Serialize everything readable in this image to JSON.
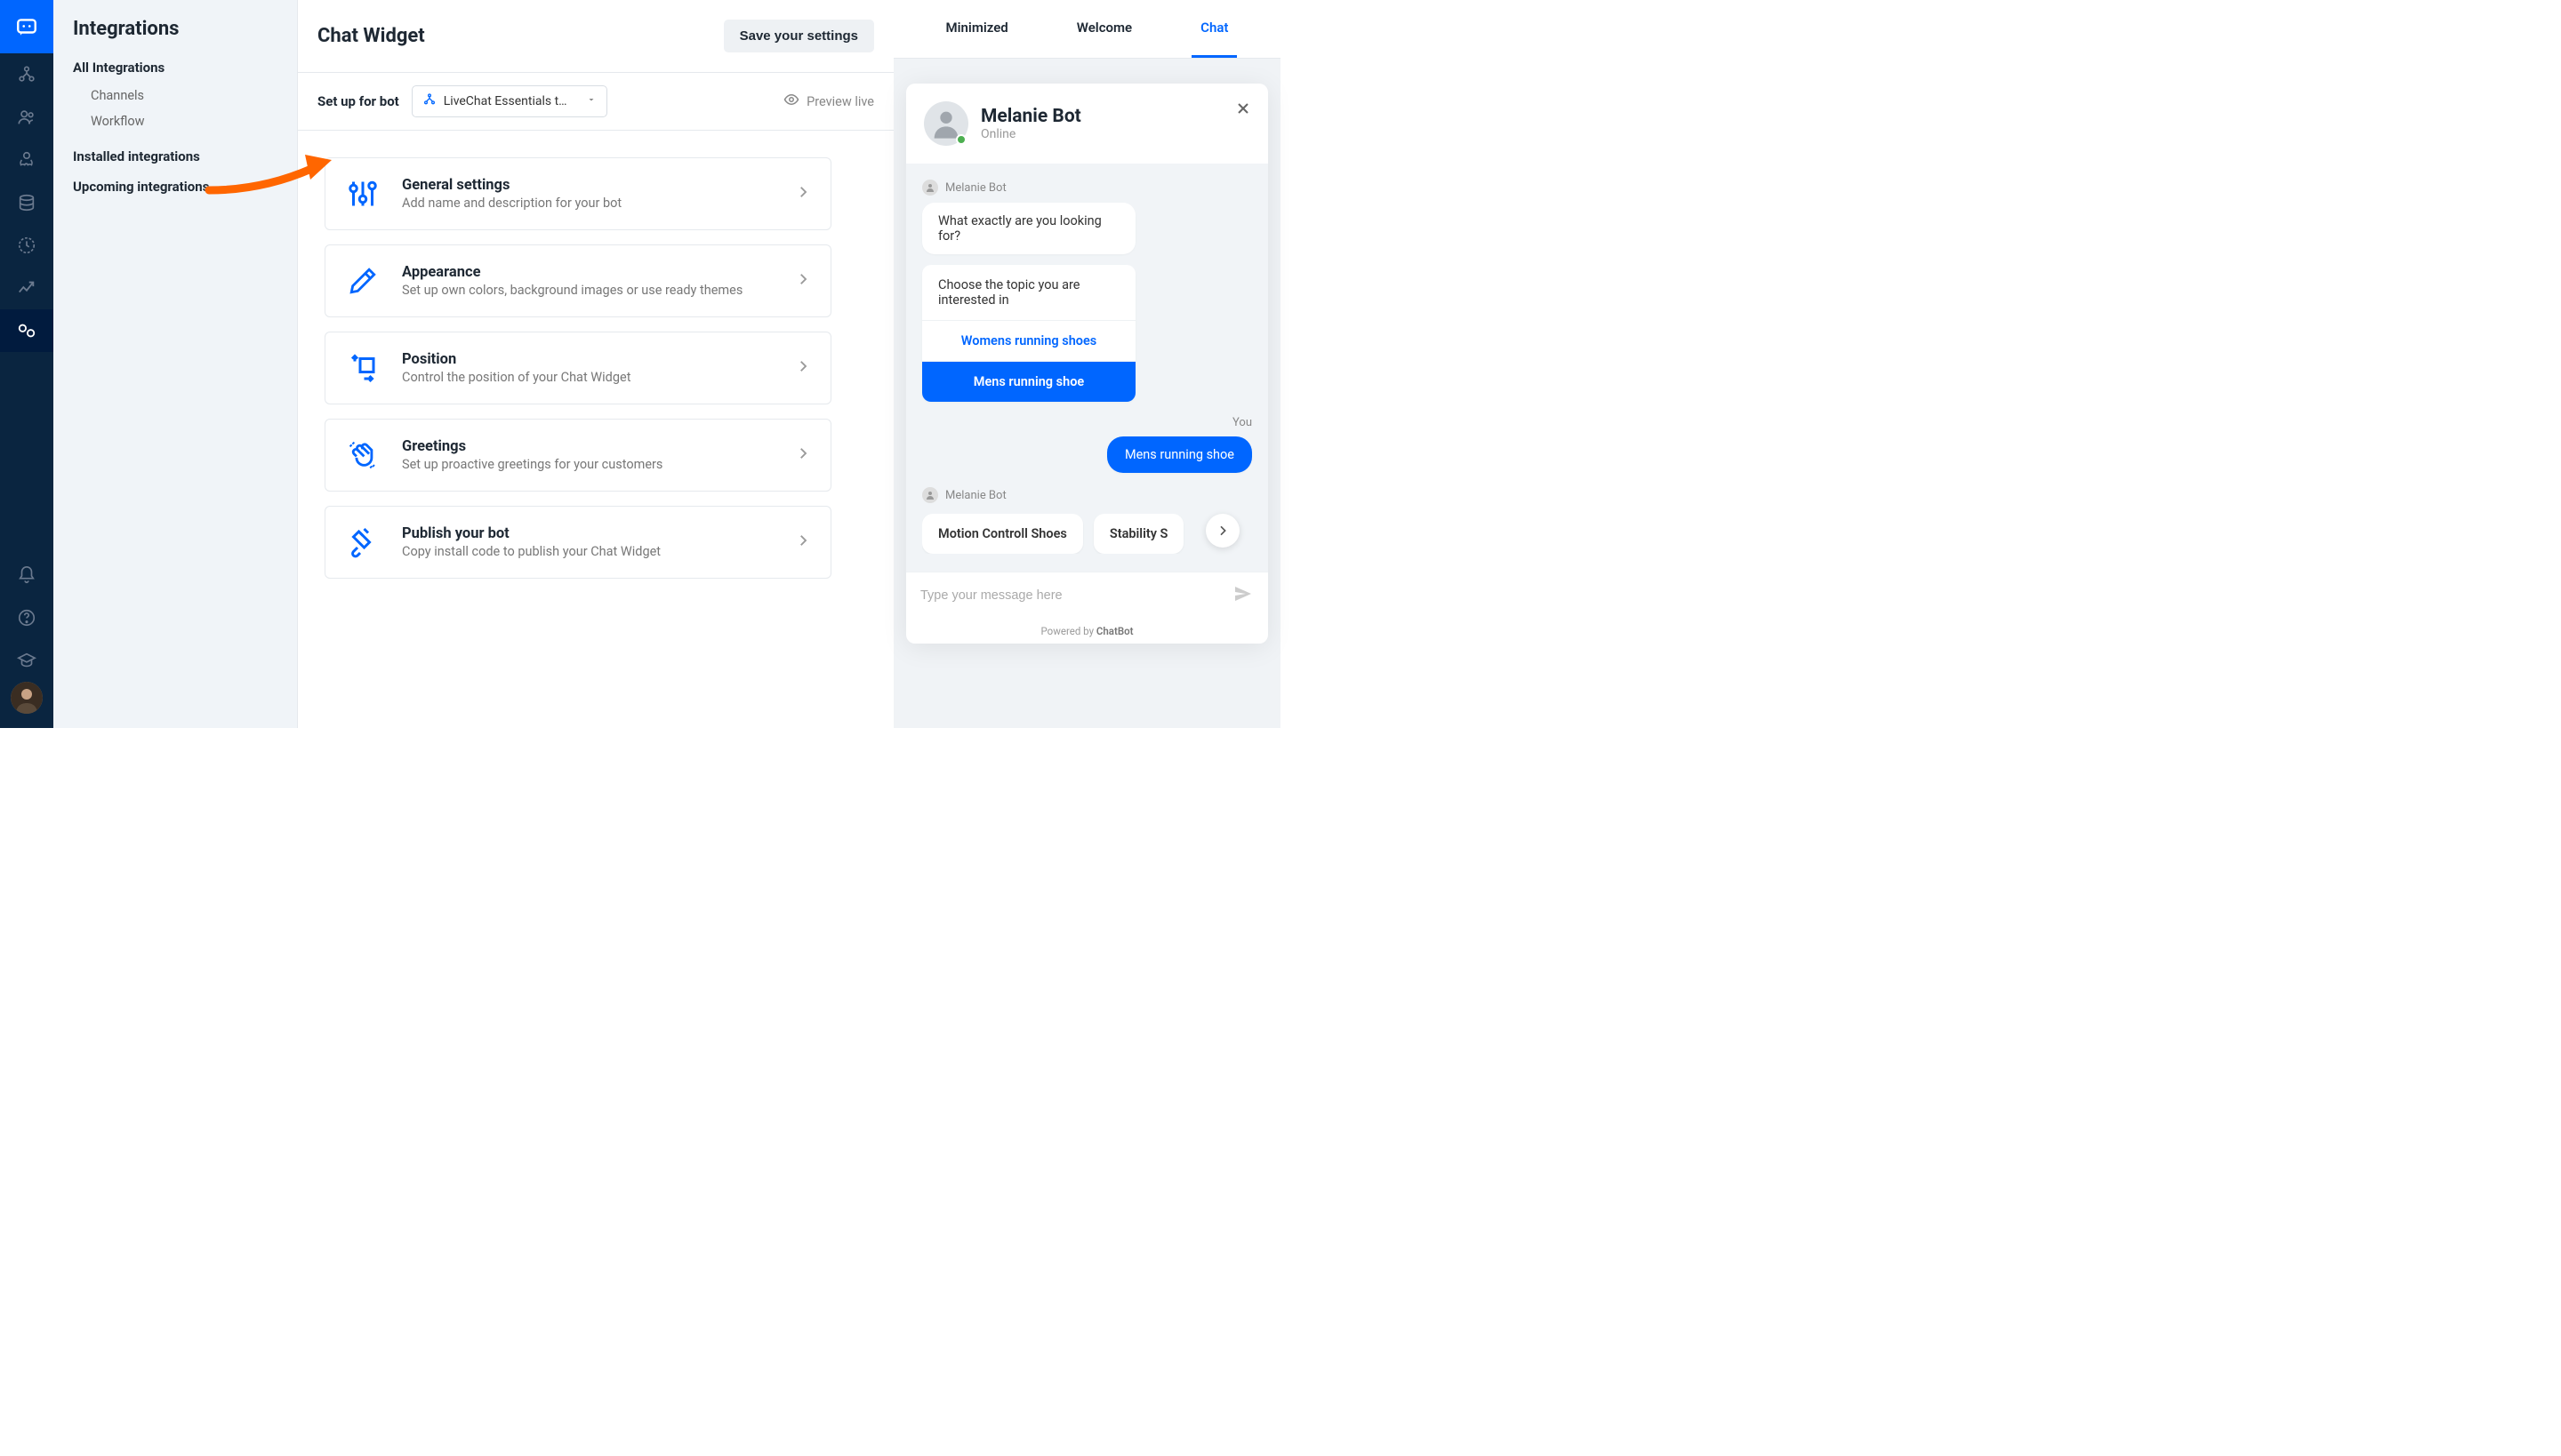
{
  "sidebar": {
    "title": "Integrations",
    "sections": [
      {
        "heading": "All Integrations",
        "items": [
          "Channels",
          "Workflow"
        ]
      },
      {
        "heading": "Installed integrations",
        "items": []
      },
      {
        "heading": "Upcoming integrations",
        "items": []
      }
    ]
  },
  "header": {
    "title": "Chat Widget",
    "save_label": "Save your settings"
  },
  "subheader": {
    "label": "Set up for bot",
    "bot_name": "LiveChat Essentials t…",
    "preview_label": "Preview live"
  },
  "cards": [
    {
      "title": "General settings",
      "desc": "Add name and description for your bot"
    },
    {
      "title": "Appearance",
      "desc": "Set up own colors, background images or use ready themes"
    },
    {
      "title": "Position",
      "desc": "Control the position of your Chat Widget"
    },
    {
      "title": "Greetings",
      "desc": "Set up proactive greetings for your customers"
    },
    {
      "title": "Publish your bot",
      "desc": "Copy install code to publish your Chat Widget"
    }
  ],
  "preview": {
    "tabs": [
      "Minimized",
      "Welcome",
      "Chat"
    ],
    "active_tab": 2
  },
  "widget": {
    "bot_name": "Melanie Bot",
    "status": "Online",
    "sender_bot": "Melanie Bot",
    "sender_user": "You",
    "messages": {
      "q1": "What exactly are you looking for?",
      "prompt": "Choose the topic you are interested in",
      "choices": [
        "Womens running shoes",
        "Mens running shoe"
      ],
      "user_pick": "Mens running shoe",
      "chips": [
        "Motion Controll Shoes",
        "Stability S"
      ]
    },
    "input_placeholder": "Type your message here",
    "powered_prefix": "Powered by ",
    "powered_brand": "ChatBot"
  },
  "colors": {
    "primary": "#0066ff",
    "nav": "#0a2540",
    "arrow": "#ff6600"
  }
}
